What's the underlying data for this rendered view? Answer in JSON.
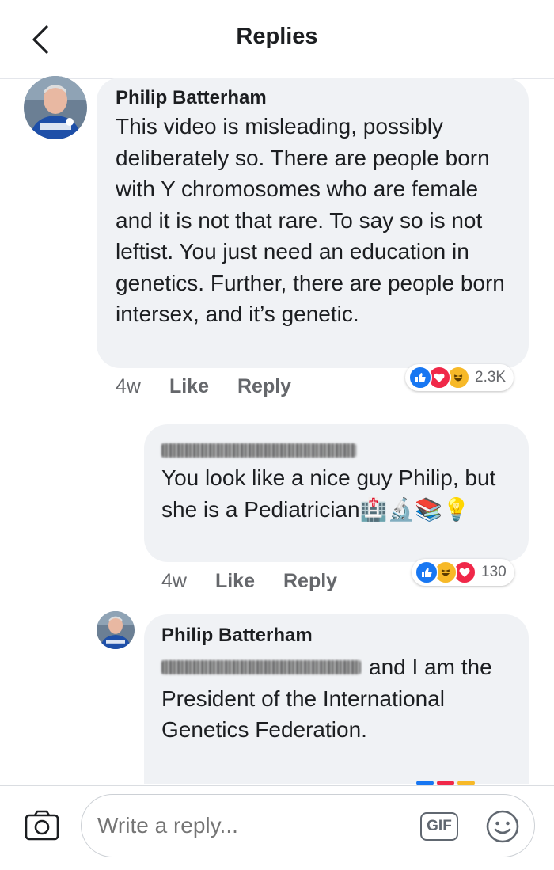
{
  "header": {
    "title": "Replies"
  },
  "comments": [
    {
      "author": "Philip Batterham",
      "text": "This video is misleading, possibly deliberately so.  There are people born with Y chromosomes who are female and it is not that rare. To say so is not leftist.  You just need an education in genetics.  Further, there are people born intersex, and it’s genetic.",
      "time": "4w",
      "like_label": "Like",
      "reply_label": "Reply",
      "reactions": [
        "like-icon",
        "love-icon",
        "haha-icon"
      ],
      "reaction_count": "2.3K"
    },
    {
      "author_redacted": true,
      "text": "You look like a nice guy Philip, but she is a Pediatrician🏥🔬📚💡",
      "time": "4w",
      "like_label": "Like",
      "reply_label": "Reply",
      "reactions": [
        "like-icon",
        "haha-icon",
        "love-icon"
      ],
      "reaction_count": "130"
    },
    {
      "author": "Philip Batterham",
      "text": "and I am the President of the International Genetics Federation."
    }
  ],
  "composer": {
    "placeholder": "Write a reply...",
    "gif_label": "GIF"
  },
  "colors": {
    "bubble": "#f0f2f5",
    "like": "#1877f2",
    "love": "#f02849",
    "haha": "#f7b928",
    "meta": "#65676b"
  }
}
